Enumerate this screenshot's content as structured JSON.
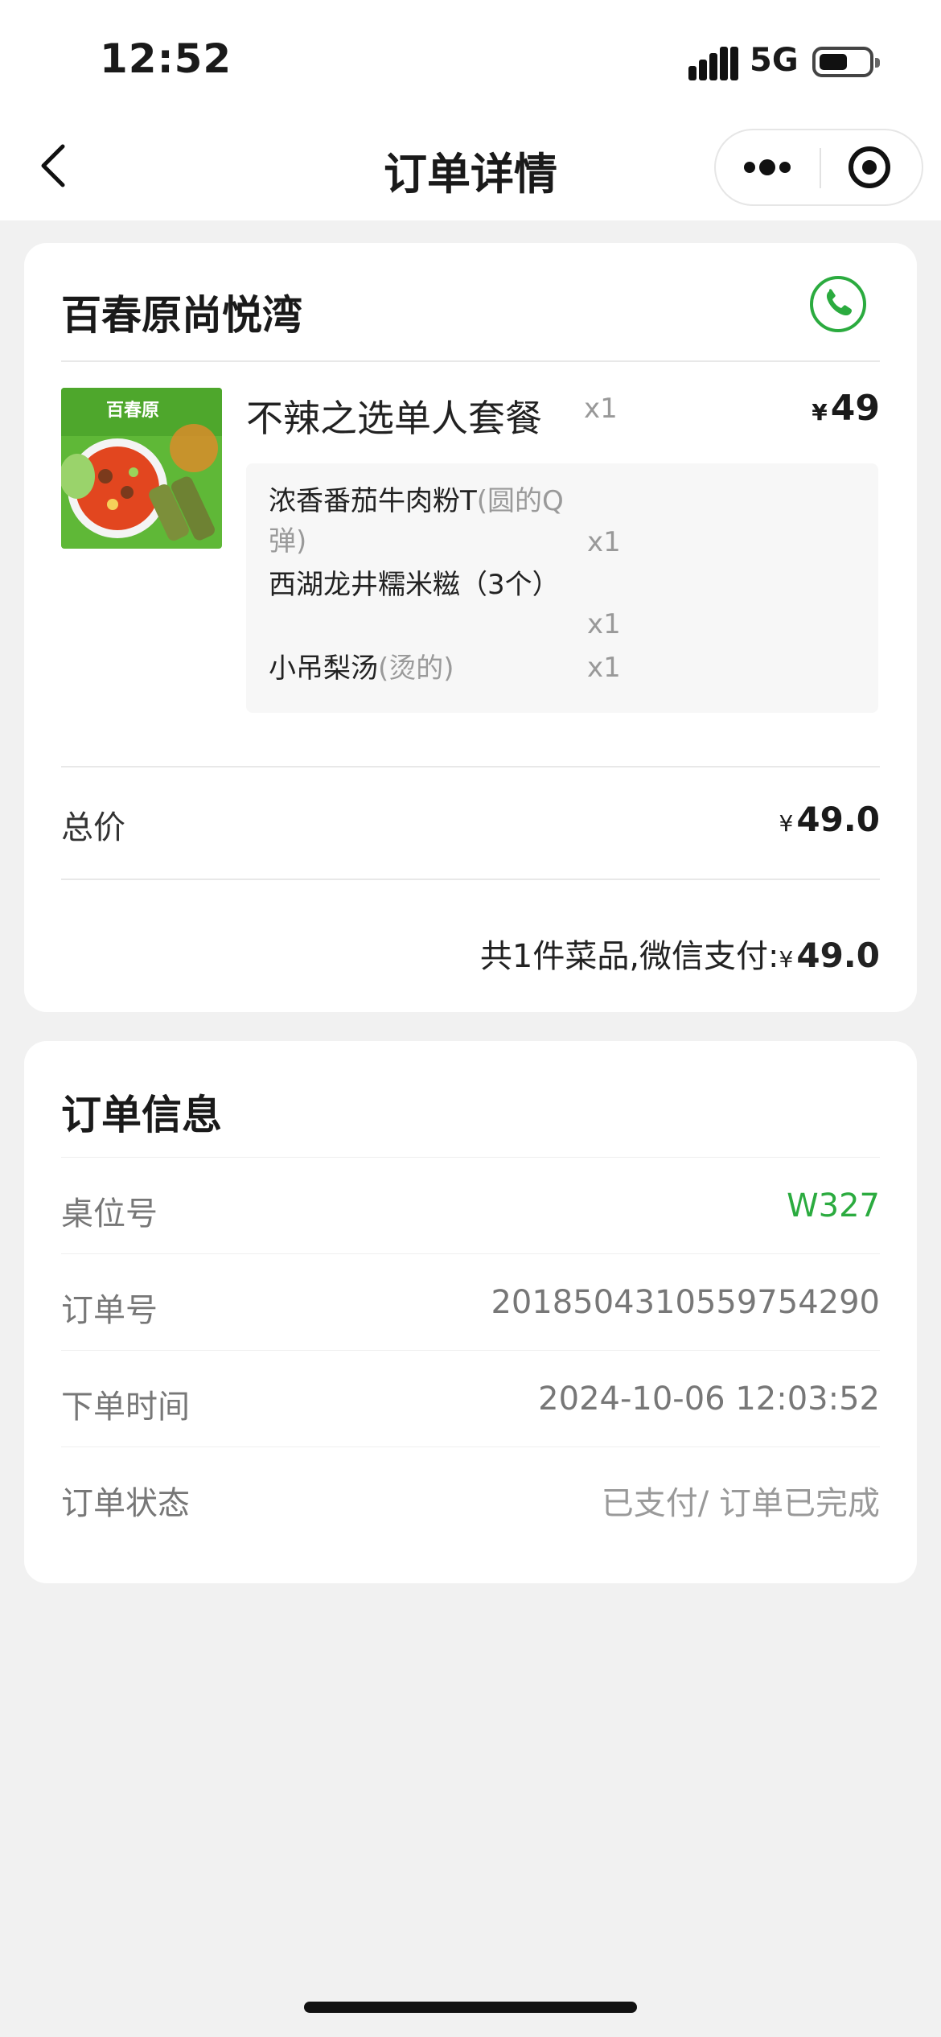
{
  "status_bar": {
    "time": "12:52",
    "network": "5G"
  },
  "nav": {
    "title": "订单详情"
  },
  "store": {
    "name": "百春原尚悦湾"
  },
  "order_item": {
    "name": "不辣之选单人套餐",
    "qty": "x1",
    "currency": "¥",
    "price": "49",
    "image_text": "百春原",
    "sub_items": [
      {
        "name": "浓香番茄牛肉粉T",
        "note": "(圆的Q弹)",
        "qty": "x1"
      },
      {
        "name": "西湖龙井糯米糍（3个）",
        "note": "",
        "qty": "x1"
      },
      {
        "name": "小吊梨汤",
        "note": "(烫的)",
        "qty": "x1"
      }
    ]
  },
  "totals": {
    "label": "总价",
    "currency": "¥",
    "value": "49.0",
    "summary_text": "共1件菜品,微信支付:",
    "summary_amount": "49.0"
  },
  "order_info": {
    "title": "订单信息",
    "rows": [
      {
        "label": "桌位号",
        "value": "W327"
      },
      {
        "label": "订单号",
        "value": "2018504310559754290"
      },
      {
        "label": "下单时间",
        "value": "2024-10-06 12:03:52"
      },
      {
        "label": "订单状态",
        "value": "已支付/ 订单已完成"
      }
    ]
  },
  "colors": {
    "accent_green": "#2bab3f",
    "background": "#f1f1f1"
  }
}
